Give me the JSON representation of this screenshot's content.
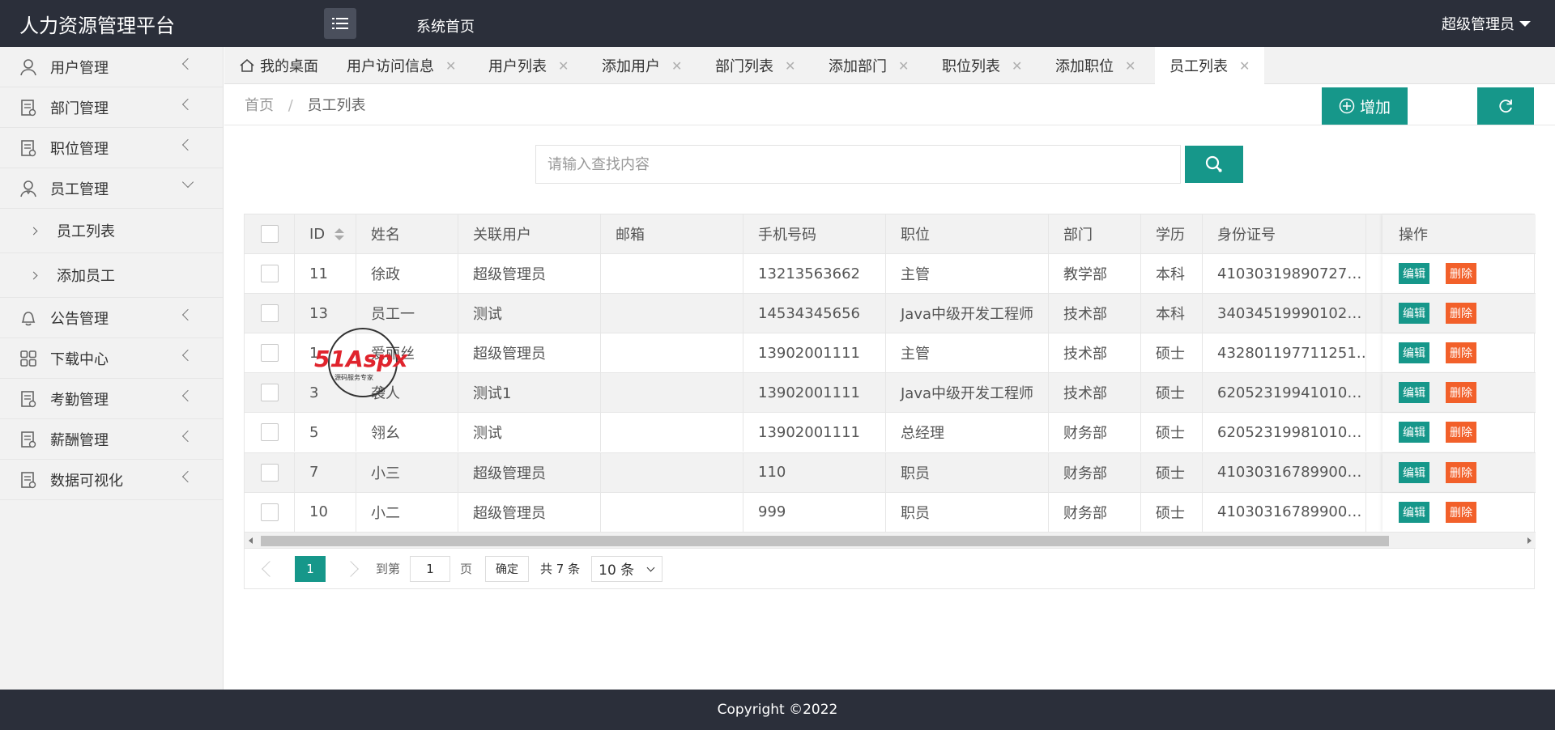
{
  "header": {
    "logo": "人力资源管理平台",
    "home_link": "系统首页",
    "user": "超级管理员"
  },
  "sidebar": {
    "items": [
      {
        "label": "用户管理",
        "icon": "user-icon"
      },
      {
        "label": "部门管理",
        "icon": "document-icon"
      },
      {
        "label": "职位管理",
        "icon": "document-icon"
      },
      {
        "label": "员工管理",
        "icon": "employee-icon",
        "expanded": true
      },
      {
        "label": "公告管理",
        "icon": "bell-icon"
      },
      {
        "label": "下载中心",
        "icon": "grid-icon"
      },
      {
        "label": "考勤管理",
        "icon": "document-icon"
      },
      {
        "label": "薪酬管理",
        "icon": "document-icon"
      },
      {
        "label": "数据可视化",
        "icon": "document-icon"
      }
    ],
    "sub_items": [
      "员工列表",
      "添加员工"
    ]
  },
  "tabs": [
    {
      "label": "我的桌面"
    },
    {
      "label": "用户访问信息"
    },
    {
      "label": "用户列表"
    },
    {
      "label": "添加用户"
    },
    {
      "label": "部门列表"
    },
    {
      "label": "添加部门"
    },
    {
      "label": "职位列表"
    },
    {
      "label": "添加职位"
    },
    {
      "label": "员工列表",
      "active": true
    }
  ],
  "tab_close": "✕",
  "breadcrumb": {
    "home": "首页",
    "sep": "/",
    "current": "员工列表"
  },
  "toolbar": {
    "add_label": "增加"
  },
  "search": {
    "placeholder": "请输入查找内容",
    "value": ""
  },
  "table": {
    "headers": [
      "ID",
      "姓名",
      "关联用户",
      "邮箱",
      "手机号码",
      "职位",
      "部门",
      "学历",
      "身份证号",
      "操作"
    ],
    "rows": [
      [
        "11",
        "徐政",
        "超级管理员",
        "",
        "13213563662",
        "主管",
        "教学部",
        "本科",
        "41030319890727…"
      ],
      [
        "13",
        "员工一",
        "测试",
        "",
        "14534345656",
        "Java中级开发工程师",
        "技术部",
        "本科",
        "34034519990102…"
      ],
      [
        "1",
        "爱丽丝",
        "超级管理员",
        "",
        "13902001111",
        "主管",
        "技术部",
        "硕士",
        "432801197711251…"
      ],
      [
        "3",
        "袭人",
        "测试1",
        "",
        "13902001111",
        "Java中级开发工程师",
        "技术部",
        "硕士",
        "62052319941010…"
      ],
      [
        "5",
        "翎幺",
        "测试",
        "",
        "13902001111",
        "总经理",
        "财务部",
        "硕士",
        "62052319981010…"
      ],
      [
        "7",
        "小三",
        "超级管理员",
        "",
        "110",
        "职员",
        "财务部",
        "硕士",
        "41030316789900…"
      ],
      [
        "10",
        "小二",
        "超级管理员",
        "",
        "999",
        "职员",
        "财务部",
        "硕士",
        "41030316789900…"
      ]
    ],
    "edit_label": "编辑",
    "delete_label": "删除"
  },
  "pagination": {
    "current_page": "1",
    "goto_label": "到第",
    "goto_value": "1",
    "page_unit": "页",
    "confirm": "确定",
    "total": "共 7 条",
    "page_size": "10 条"
  },
  "watermark": {
    "brand": "51Aspx",
    "tagline": "源码服务专家"
  },
  "footer": {
    "copyright": "Copyright ©2022"
  },
  "colors": {
    "accent": "#16978a",
    "danger": "#f2602a",
    "header_bg": "#2b2f3a"
  }
}
